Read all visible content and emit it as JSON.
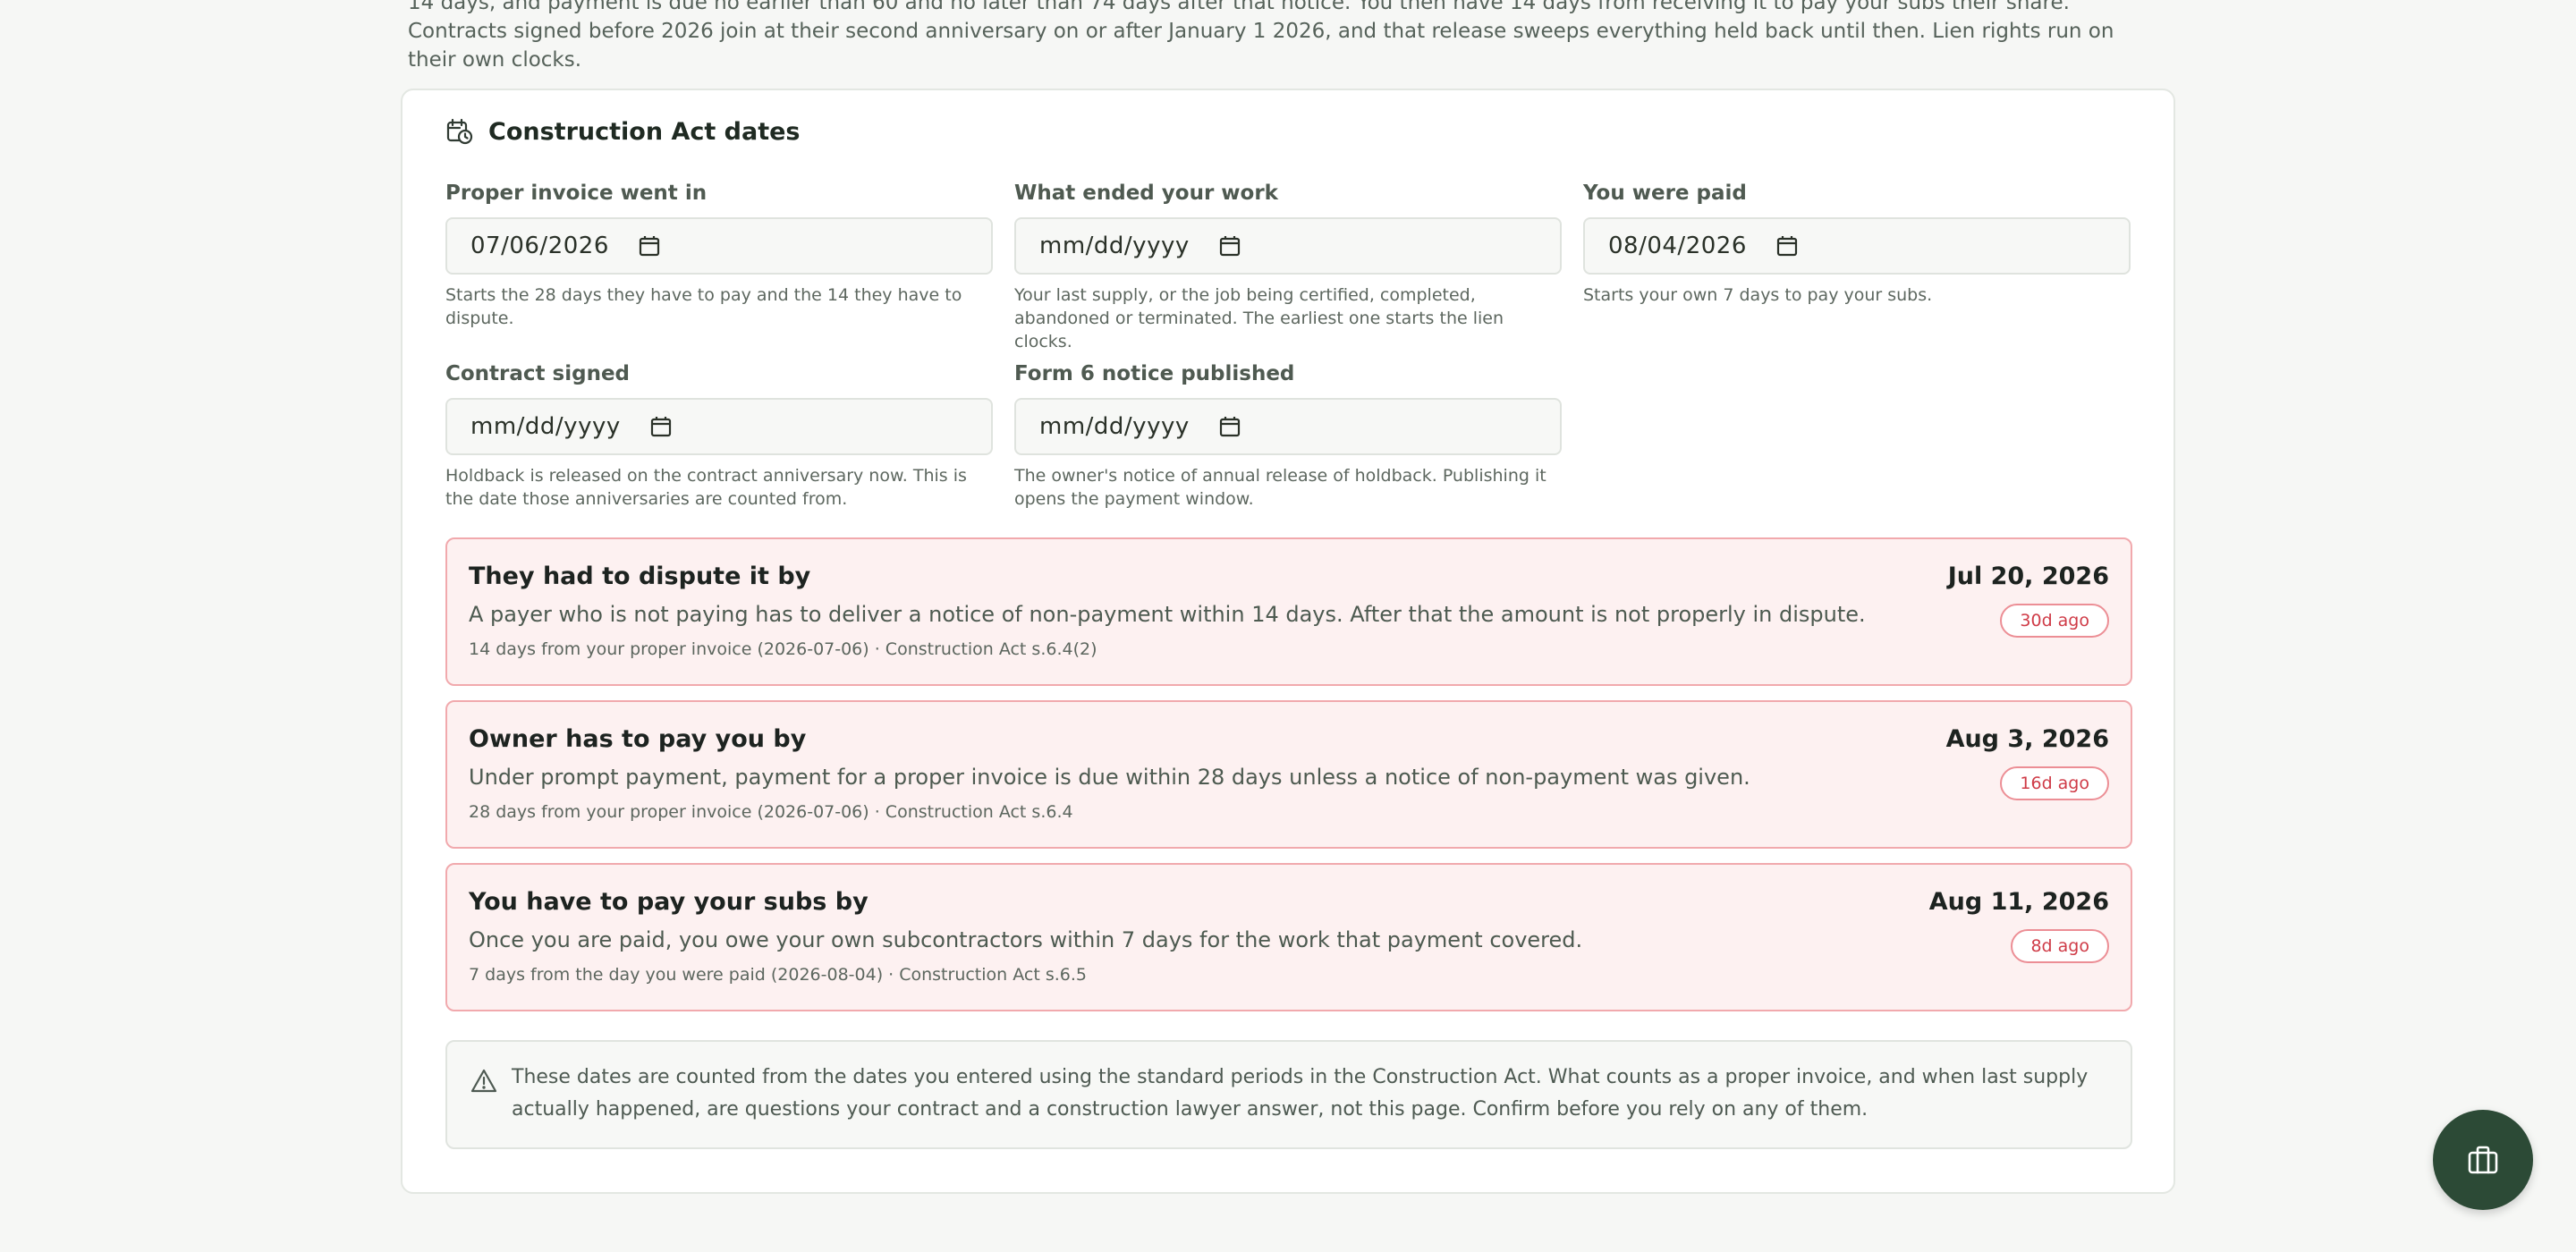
{
  "intro": {
    "text": "14 days, and payment is due no earlier than 60 and no later than 74 days after that notice. You then have 14 days from receiving it to pay your subs their share. Contracts signed before 2026 join at their second anniversary on or after January 1 2026, and that release sweeps everything held back until then. Lien rights run on their own clocks."
  },
  "card": {
    "title": "Construction Act dates",
    "title_icon": "calendar-clock-icon"
  },
  "fields": {
    "invoice": {
      "label": "Proper invoice went in",
      "value": "07/06/2026",
      "hint": "Starts the 28 days they have to pay and the 14 they have to dispute."
    },
    "work_end": {
      "label": "What ended your work",
      "value": "mm/dd/yyyy",
      "hint": "Your last supply, or the job being certified, completed, abandoned or terminated. The earliest one starts the lien clocks."
    },
    "paid": {
      "label": "You were paid",
      "value": "08/04/2026",
      "hint": "Starts your own 7 days to pay your subs."
    },
    "contract": {
      "label": "Contract signed",
      "value": "mm/dd/yyyy",
      "hint": "Holdback is released on the contract anniversary now. This is the date those anniversaries are counted from."
    },
    "form6": {
      "label": "Form 6 notice published",
      "value": "mm/dd/yyyy",
      "hint": "The owner's notice of annual release of holdback. Publishing it opens the payment window."
    }
  },
  "deadlines": [
    {
      "title": "They had to dispute it by",
      "description": "A payer who is not paying has to deliver a notice of non-payment within 14 days. After that the amount is not properly in dispute.",
      "source": "14 days from your proper invoice (2026-07-06) · Construction Act s.6.4(2)",
      "date": "Jul 20, 2026",
      "badge": "30d ago"
    },
    {
      "title": "Owner has to pay you by",
      "description": "Under prompt payment, payment for a proper invoice is due within 28 days unless a notice of non-payment was given.",
      "source": "28 days from your proper invoice (2026-07-06) · Construction Act s.6.4",
      "date": "Aug 3, 2026",
      "badge": "16d ago"
    },
    {
      "title": "You have to pay your subs by",
      "description": "Once you are paid, you owe your own subcontractors within 7 days for the work that payment covered.",
      "source": "7 days from the day you were paid (2026-08-04) · Construction Act s.6.5",
      "date": "Aug 11, 2026",
      "badge": "8d ago"
    }
  ],
  "disclaimer": {
    "icon": "warning-triangle-icon",
    "text": "These dates are counted from the dates you entered using the standard periods in the Construction Act. What counts as a proper invoice, and when last supply actually happened, are questions your contract and a construction lawyer answer, not this page. Confirm before you rely on any of them."
  },
  "help_button": {
    "icon": "briefcase-icon"
  },
  "colors": {
    "accent": "#2c4a36",
    "overdue_bg": "#fdf1f1",
    "overdue_border": "#f1a9ad",
    "overdue_text": "#cf3b47"
  }
}
